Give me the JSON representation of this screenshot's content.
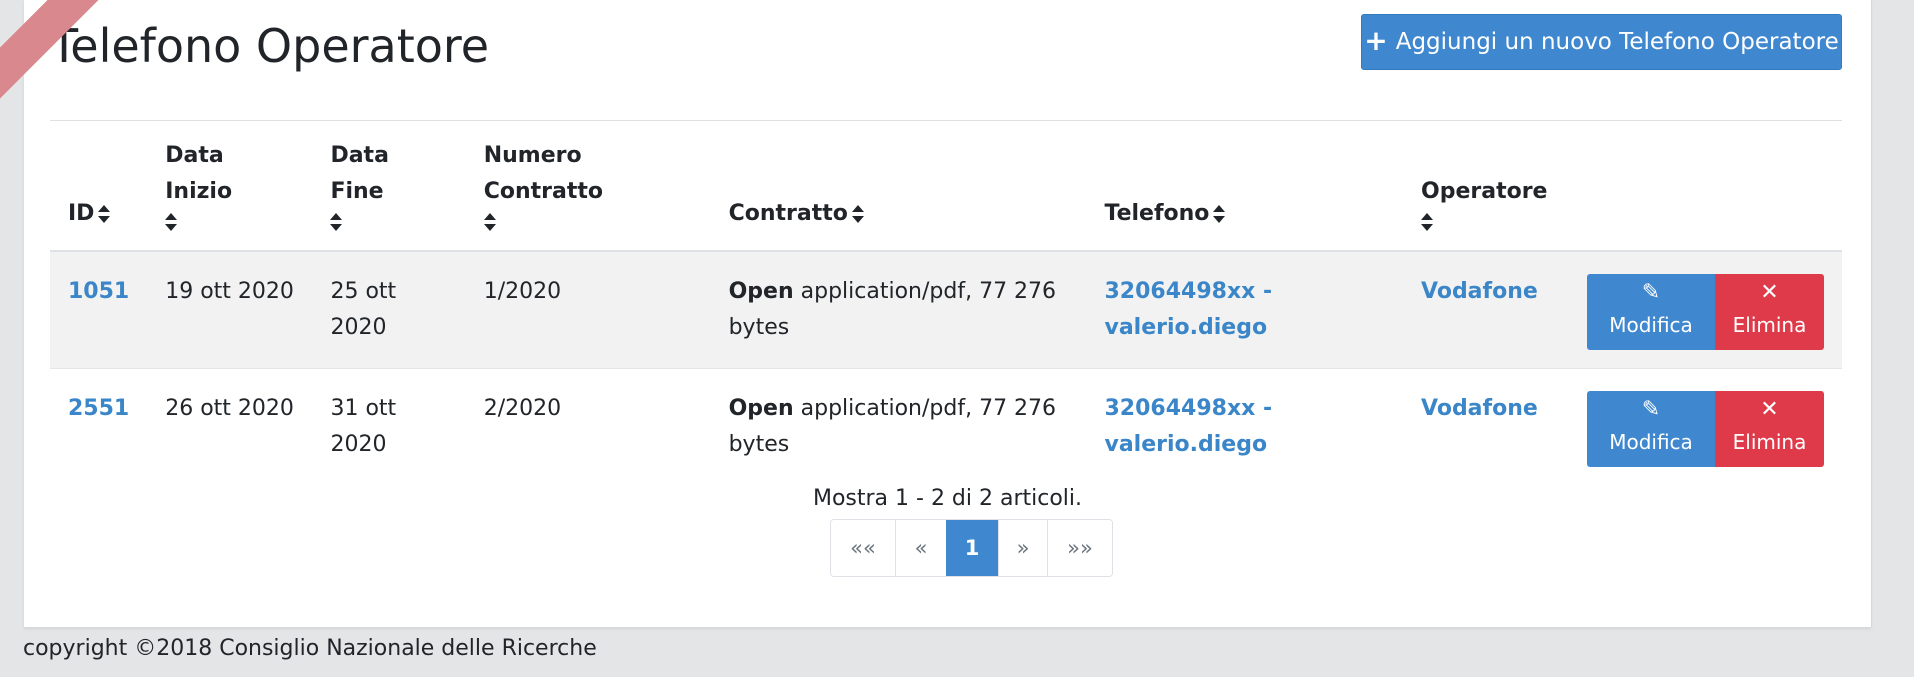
{
  "page": {
    "title": "Telefono Operatore",
    "add_button": "Aggiungi un nuovo Telefono Operatore"
  },
  "table": {
    "headers": {
      "id": "ID",
      "data_inizio": "Data Inizio",
      "data_fine": "Data Fine",
      "numero_contratto": "Numero Contratto",
      "contratto": "Contratto",
      "telefono": "Telefono",
      "operatore": "Operatore"
    },
    "rows": [
      {
        "id": "1051",
        "data_inizio": "19 ott 2020",
        "data_fine": "25 ott 2020",
        "numero_contratto": "1/2020",
        "contratto_link": "Open",
        "contratto_info": "application/pdf, 77 276 bytes",
        "telefono": "32064498xx - valerio.diego",
        "operatore": "Vodafone"
      },
      {
        "id": "2551",
        "data_inizio": "26 ott 2020",
        "data_fine": "31 ott 2020",
        "numero_contratto": "2/2020",
        "contratto_link": "Open",
        "contratto_info": "application/pdf, 77 276 bytes",
        "telefono": "32064498xx - valerio.diego",
        "operatore": "Vodafone"
      }
    ],
    "actions": {
      "edit": "Modifica",
      "delete": "Elimina"
    }
  },
  "pagination": {
    "summary": "Mostra 1 - 2 di 2 articoli.",
    "first": "««",
    "prev": "«",
    "current": "1",
    "next": "»",
    "last": "»»"
  },
  "footer": {
    "copyright": "copyright ©2018 Consiglio Nazionale delle Ricerche"
  },
  "icons": {
    "add": "plus-icon",
    "edit": "pencil-icon",
    "delete": "x-icon",
    "sort": "sort-icon",
    "ribbon": "ribbon-icon"
  },
  "colors": {
    "primary": "#3f88cf",
    "danger": "#df3a4a",
    "link": "#3a86c8",
    "ribbon": "#d9888d",
    "background": "#e4e5e7"
  }
}
